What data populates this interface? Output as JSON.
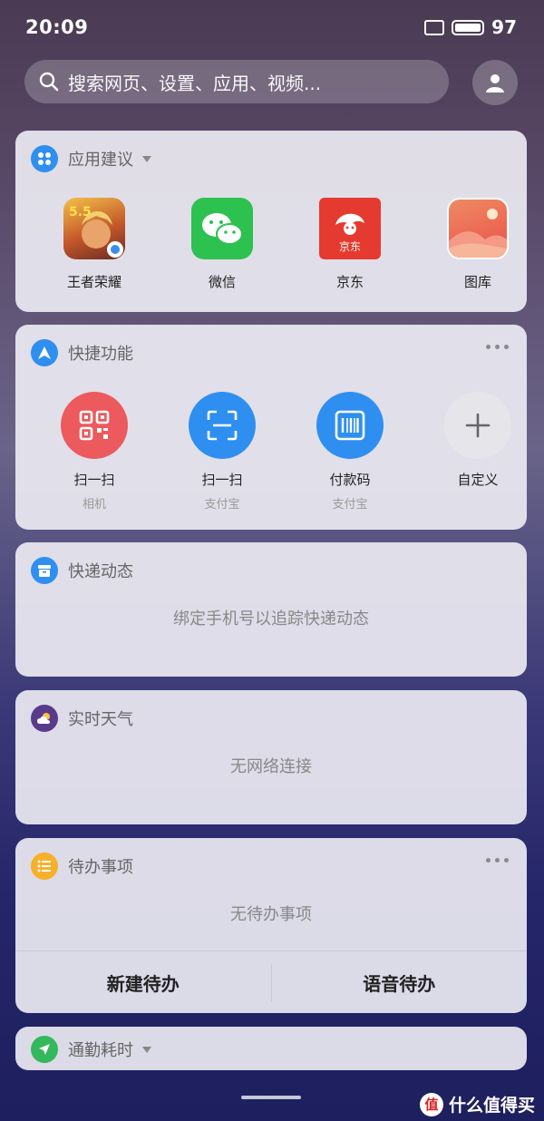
{
  "status_bar": {
    "time": "20:09",
    "battery_level": "97"
  },
  "search": {
    "placeholder": "搜索网页、设置、应用、视频..."
  },
  "app_suggestions": {
    "title": "应用建议",
    "apps": [
      {
        "label": "王者荣耀",
        "icon": "game-honor-of-kings-icon"
      },
      {
        "label": "微信",
        "icon": "wechat-icon"
      },
      {
        "label": "京东",
        "icon": "jd-icon"
      },
      {
        "label": "图库",
        "icon": "gallery-icon"
      }
    ]
  },
  "shortcuts": {
    "title": "快捷功能",
    "items": [
      {
        "label": "扫一扫",
        "sub": "相机",
        "icon": "qr-code-icon",
        "color": "#ec5a5e"
      },
      {
        "label": "扫一扫",
        "sub": "支付宝",
        "icon": "scan-icon",
        "color": "#2f8ff0"
      },
      {
        "label": "付款码",
        "sub": "支付宝",
        "icon": "barcode-icon",
        "color": "#2f8ff0"
      },
      {
        "label": "自定义",
        "sub": "",
        "icon": "plus-icon",
        "color": "#e6e6ea"
      }
    ]
  },
  "express": {
    "title": "快递动态",
    "message": "绑定手机号以追踪快递动态"
  },
  "weather": {
    "title": "实时天气",
    "message": "无网络连接"
  },
  "todo": {
    "title": "待办事项",
    "message": "无待办事项",
    "new_label": "新建待办",
    "voice_label": "语音待办"
  },
  "commute": {
    "title": "通勤耗时"
  },
  "watermark": {
    "badge": "值",
    "text": "什么值得买"
  }
}
